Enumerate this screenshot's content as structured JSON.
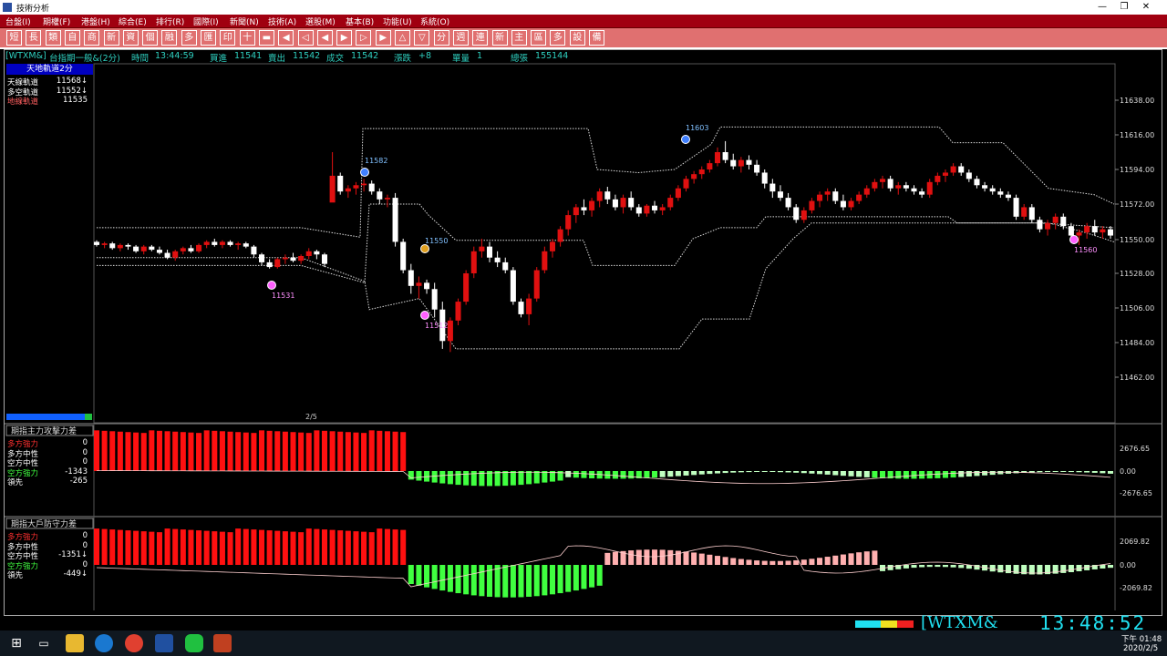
{
  "window": {
    "title": "技術分析",
    "minimize": "—",
    "restore": "❐",
    "close": "✕"
  },
  "menu": [
    "台盤(I)",
    "期權(F)",
    "港盤(H)",
    "綜合(E)",
    "排行(R)",
    "國際(I)",
    "新聞(N)",
    "技術(A)",
    "選股(M)",
    "基本(B)",
    "功能(U)",
    "系統(O)"
  ],
  "toolbar": [
    "短",
    "長",
    "類",
    "自",
    "商",
    "新",
    "資",
    "個",
    "融",
    "多",
    "匯",
    "印",
    "十",
    "▬",
    "◀",
    "◁",
    "◀",
    "▶",
    "▷",
    "▶",
    "△",
    "▽",
    "分",
    "週",
    "連",
    "新",
    "主",
    "區",
    "多",
    "設",
    "備"
  ],
  "quote": {
    "symbol": "[WTXM&]",
    "name": "台指期一般&(2分)",
    "time_label": "時間",
    "time": "13:44:59",
    "bid_label": "買進",
    "bid": "11541",
    "ask_label": "賣出",
    "ask": "11542",
    "last_label": "成交",
    "last": "11542",
    "change_label": "漲跌",
    "change": "+8",
    "vol_label": "單量",
    "vol": "1",
    "total_label": "總張",
    "total": "155144"
  },
  "main_panel": {
    "title": "天地軌道2分",
    "rows": [
      {
        "label": "天線軌道",
        "value": "11568↓",
        "color": "#ffffff"
      },
      {
        "label": "多空軌道",
        "value": "11552↓",
        "color": "#ffffff"
      },
      {
        "label": "地線軌道",
        "value": "11535",
        "color": "#ff6060"
      }
    ],
    "y_ticks": [
      "11638.00",
      "11616.00",
      "11594.00",
      "11572.00",
      "11550.00",
      "11528.00",
      "11506.00",
      "11484.00",
      "11462.00"
    ],
    "date_label": "2/5",
    "markers": [
      "11582",
      "11603",
      "11550",
      "11531",
      "11512",
      "11560"
    ]
  },
  "sub_panel_1": {
    "title": "期指主力攻擊力差",
    "rows": [
      {
        "label": "多方強力",
        "value": "0",
        "color": "#ff3030"
      },
      {
        "label": "多方中性",
        "value": "0",
        "color": "#ffffff"
      },
      {
        "label": "空方中性",
        "value": "0",
        "color": "#ffffff"
      },
      {
        "label": "空方強力",
        "value": "-1343",
        "color": "#40ff40"
      },
      {
        "label": "領先",
        "value": "-265",
        "color": "#ffffff"
      }
    ],
    "y_ticks": [
      "2676.65",
      "0.00",
      "-2676.65"
    ]
  },
  "sub_panel_2": {
    "title": "期指大戶防守力差",
    "rows": [
      {
        "label": "多方強力",
        "value": "0",
        "color": "#ff3030"
      },
      {
        "label": "多方中性",
        "value": "0",
        "color": "#ffffff"
      },
      {
        "label": "空方中性",
        "value": "-1351↓",
        "color": "#ffffff"
      },
      {
        "label": "空方強力",
        "value": "0",
        "color": "#40ff40"
      },
      {
        "label": "領先",
        "value": "-449↓",
        "color": "#ffffff"
      }
    ],
    "y_ticks": [
      "2069.82",
      "0.00",
      "-2069.82"
    ]
  },
  "ticker": {
    "text": "[WTXM&",
    "clock": "13:48:52"
  },
  "taskbar": {
    "time": "下午 01:48",
    "date": "2020/2/5"
  },
  "colors": {
    "up": "#e01010",
    "down": "#ffffff",
    "menu": "#a00010",
    "toolbar": "#e07070",
    "info": "#2fd0c0"
  }
}
